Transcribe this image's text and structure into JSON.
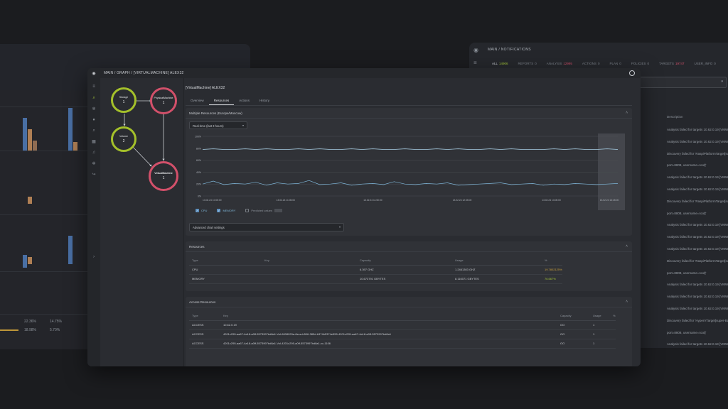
{
  "header": {
    "breadcrumb": "MAIN  /  GRAPH  /  [VIRTUALMACHINE] ALEX32"
  },
  "graph": {
    "nodes": [
      {
        "name": "Storage",
        "count": "1",
        "color": "green"
      },
      {
        "name": "PhysicalMachine",
        "count": "1",
        "color": "pink"
      },
      {
        "name": "Volume",
        "count": "2",
        "color": "green"
      },
      {
        "name": "VirtualMachine",
        "count": "1",
        "color": "pink"
      }
    ]
  },
  "page": {
    "title": "[VirtualMachine] ALEX32",
    "tabs": [
      "Overview",
      "Resources",
      "Actions",
      "History"
    ],
    "active_tab": "Resources"
  },
  "multiple_resources": {
    "title": "Multiple Resources (Europe/Moscow)",
    "range_select": "Real-time (last 3 hours)",
    "legend": [
      {
        "label": "CPU",
        "checked": true
      },
      {
        "label": "MEMORY",
        "checked": true
      },
      {
        "label": "Predicted values",
        "checked": false
      }
    ],
    "advanced": "Advanced chart settings"
  },
  "chart_data": {
    "type": "line",
    "ylabels": [
      "100%",
      "80%",
      "60%",
      "40%",
      "20%",
      "0%"
    ],
    "xlabels": [
      "13.02.24 10:05:00",
      "13.02.24 11:05:00",
      "13.02.24 11:50:00",
      "13.02.24 12:35:00",
      "13.02.24 13:05:00",
      "13.02.24 13:45:00"
    ],
    "ylim": [
      0,
      100
    ],
    "series": [
      {
        "name": "CPU",
        "color": "#a8d0e6",
        "values": [
          78,
          79,
          78,
          78,
          79,
          78,
          79,
          78,
          78,
          79,
          78,
          79,
          78,
          78,
          79,
          78,
          79,
          78,
          78,
          79,
          78,
          78,
          79,
          78,
          79,
          78,
          78,
          79,
          78,
          79,
          78,
          78,
          78,
          79,
          78,
          79,
          78,
          78,
          79,
          78
        ]
      },
      {
        "name": "MEMORY",
        "color": "#7fb7d9",
        "values": [
          20,
          25,
          19,
          21,
          20,
          23,
          18,
          22,
          20,
          21,
          26,
          19,
          20,
          22,
          18,
          20,
          21,
          19,
          24,
          20,
          19,
          21,
          20,
          22,
          18,
          19,
          20,
          21,
          22,
          19,
          20,
          21,
          18,
          20,
          19,
          21,
          20,
          19,
          20,
          21
        ]
      }
    ]
  },
  "resources_table": {
    "title": "Resources",
    "headers": [
      "Type",
      "Key",
      "Capacity",
      "Usage",
      "%"
    ],
    "rows": [
      {
        "type": "CPU",
        "key": "",
        "capacity": "6.397 GHZ",
        "usage": "1.2461303 GHZ",
        "pct": "19.7802125%",
        "pct_color": "#d0a43c"
      },
      {
        "type": "MEMORY",
        "key": "",
        "capacity": "10.673791 GBYTES",
        "usage": "8.116071 GBYTES",
        "pct": "76.667%",
        "pct_color": "#a4c639"
      }
    ]
  },
  "access_table": {
    "title": "Access Resources",
    "headers": [
      "Type",
      "Key",
      "Capacity",
      "Usage",
      "%"
    ],
    "rows": [
      {
        "type": "ACCESS",
        "key": "10.62.0.19",
        "capacity": "OO",
        "usage": "1",
        "pct": ""
      },
      {
        "type": "ACCESS",
        "key": "4201c295-aa67-4a18-a0ff-5573997bd8a1-Vol-6008029a-8eca-b506-385d-b374b5374e555-4201c295-aa67-4a18-a0ff-5573997bd8a1",
        "capacity": "OO",
        "usage": "1",
        "pct": ""
      },
      {
        "type": "ACCESS",
        "key": "4201c295-aa67-4a18-a0ff-5573997bd8a1-Vol-4201c295-a0ff-5573997bd8a1-vc-1106",
        "capacity": "OO",
        "usage": "1",
        "pct": ""
      }
    ]
  },
  "notifications": {
    "breadcrumb": "MAIN  /  NOTIFICATIONS",
    "tabs": [
      {
        "label": "ALL",
        "count": "14906"
      },
      {
        "label": "REPORTS",
        "count": "0"
      },
      {
        "label": "ANALYSIS",
        "count": "12995"
      },
      {
        "label": "ACTIONS",
        "count": "0"
      },
      {
        "label": "PLAN",
        "count": "0"
      },
      {
        "label": "POLICIES",
        "count": "0"
      },
      {
        "label": "TARGETS",
        "count": "19747"
      },
      {
        "label": "USER_INFO",
        "count": "0"
      }
    ],
    "column": "Description",
    "messages": [
      "Analysis failed for targets 10.62.0.19 [VMWA",
      "Analysis failed for targets 10.62.0.19 [VMWA",
      "Discovery failed for 'RaspiPlatformTarget[sup",
      "port=8808, username=root]'",
      "Analysis failed for targets 10.62.0.19 [VMWA",
      "Analysis failed for targets 10.62.0.19 [VMWA",
      "Discovery failed for 'RaspiPlatformTarget[sup",
      "port=8808, username=root]'",
      "Analysis failed for targets 10.62.0.19 [VMWA",
      "Analysis failed for targets 10.62.0.19 [VMWA",
      "Analysis failed for targets 10.62.0.19 [VMWA",
      "Discovery failed for 'RaspiPlatformTarget[sup",
      "port=8808, username=root]'",
      "Analysis failed for targets 10.62.0.19 [VMWA",
      "Analysis failed for targets 10.62.0.19 [VMWA",
      "Analysis failed for targets 10.62.0.19 [VMWA",
      "Discovery failed for 'HyperVTarget[super-Bas",
      "port=8808, username=root]'",
      "Analysis failed for targets 10.62.0.19 [VMWA",
      "Analysis failed for targets 10.62.0.19 [VMWA",
      "Discovery failed for 'RaspiPlatformTarget[sup"
    ]
  },
  "left_stats": {
    "rows": [
      {
        "a": "22.36%",
        "b": "14.75%"
      },
      {
        "a": "18.98%",
        "b": "5.70%"
      }
    ]
  }
}
